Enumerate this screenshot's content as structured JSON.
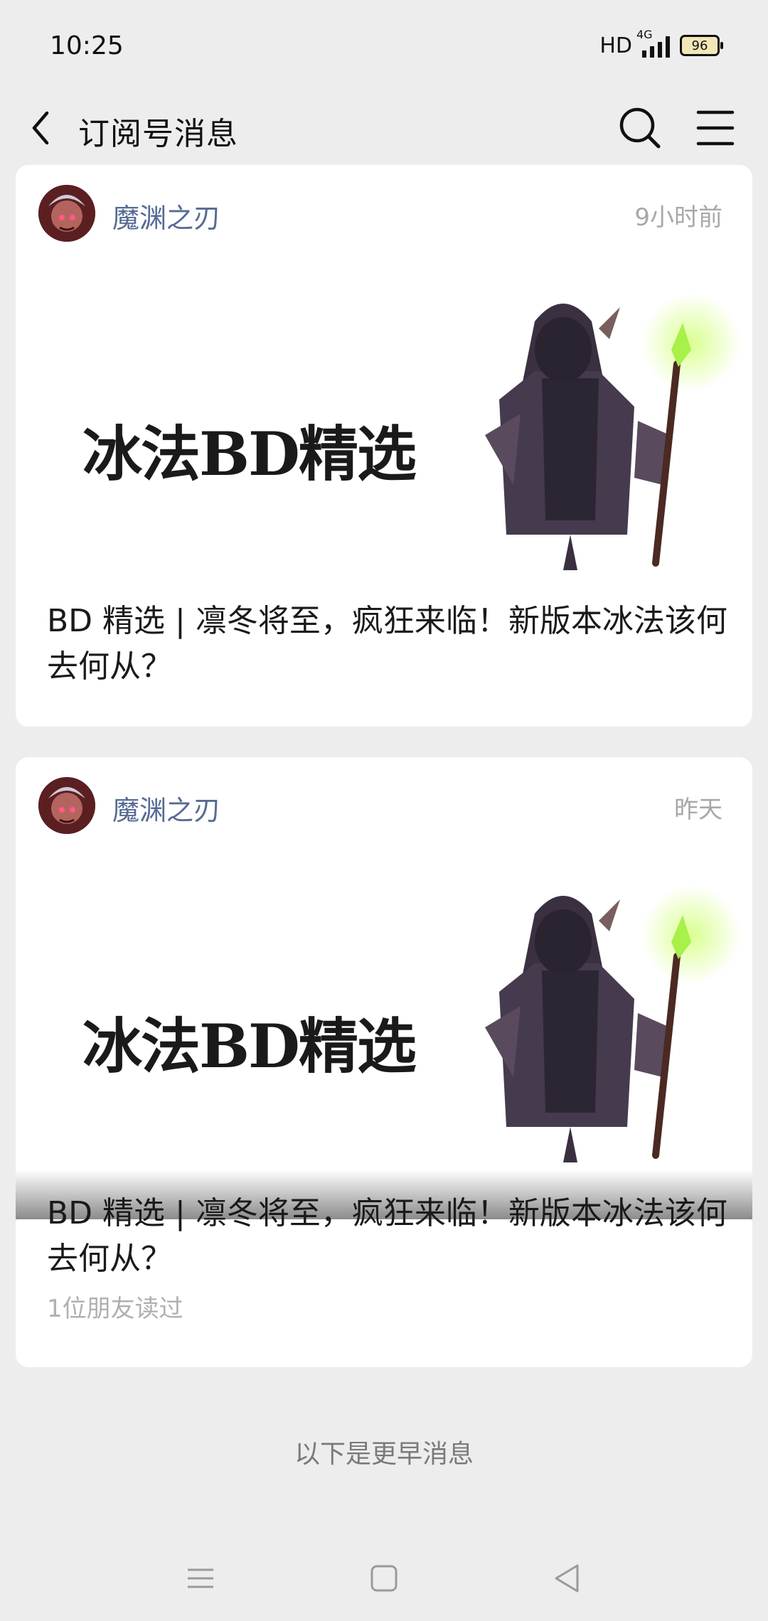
{
  "status": {
    "time": "10:25",
    "hd": "HD",
    "network": "4G",
    "battery": "96"
  },
  "nav": {
    "title": "订阅号消息",
    "back_icon": "back-arrow-icon",
    "search_icon": "search-icon",
    "menu_icon": "menu-icon"
  },
  "messages": [
    {
      "account": "魔渊之刃",
      "time": "9小时前",
      "cover_text": "冰法BD精选",
      "title": "BD 精选 | 凛冬将至，疯狂来临！新版本冰法该何去何从？"
    },
    {
      "account": "魔渊之刃",
      "time": "昨天",
      "cover_text": "冰法BD精选",
      "title": "BD 精选 | 凛冬将至，疯狂来临！新版本冰法该何去何从？",
      "read_by": "1位朋友读过"
    }
  ],
  "earlier_label": "以下是更早消息",
  "system_nav": [
    "recents-icon",
    "home-icon",
    "back-icon"
  ],
  "colors": {
    "background": "#ededed",
    "account_name": "#576b95",
    "staff_glow": "#b6f25c"
  }
}
